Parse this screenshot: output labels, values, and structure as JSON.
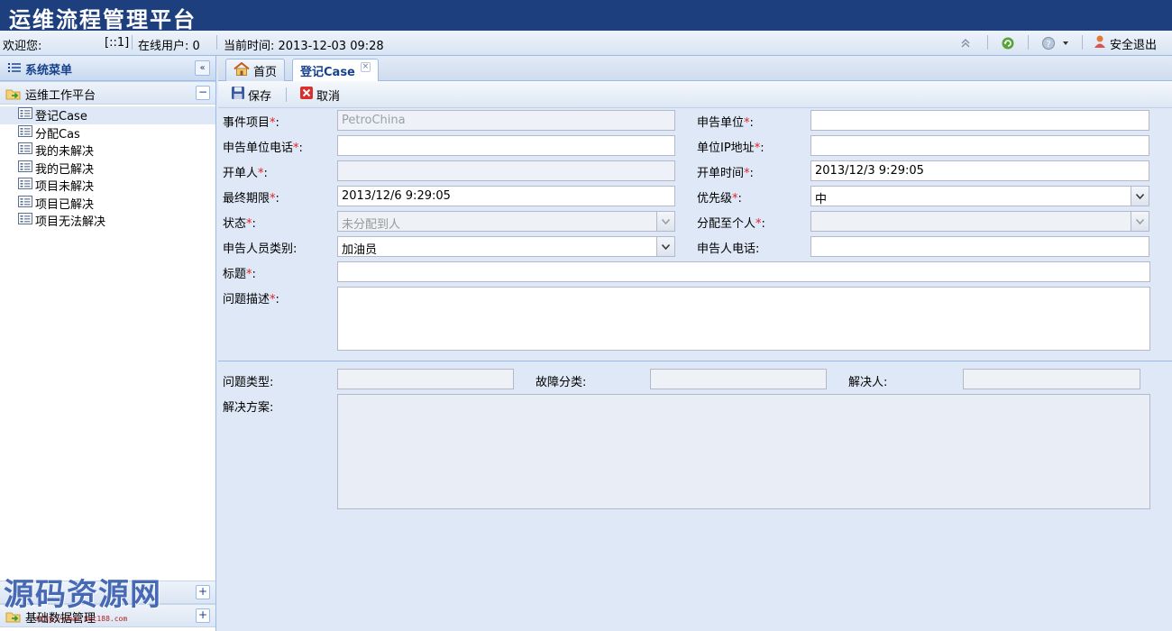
{
  "app": {
    "title": "运维流程管理平台"
  },
  "status": {
    "welcome": "欢迎您:",
    "user_ip": "[::1]",
    "online_users": "在线用户: 0",
    "current_time": "当前时间: 2013-12-03 09:28",
    "logout": "安全退出"
  },
  "sidebar": {
    "title": "系统菜单",
    "groups": [
      {
        "label": "运维工作平台",
        "expanded": true
      },
      {
        "label": "基础数据管理",
        "expanded": false
      }
    ],
    "items": [
      {
        "label": "登记Case"
      },
      {
        "label": "分配Cas"
      },
      {
        "label": "我的未解决"
      },
      {
        "label": "我的已解决"
      },
      {
        "label": "项目未解决"
      },
      {
        "label": "项目已解决"
      },
      {
        "label": "项目无法解决"
      }
    ]
  },
  "tabs": [
    {
      "label": "首页",
      "icon": "home-icon"
    },
    {
      "label": "登记Case",
      "active": true
    }
  ],
  "toolbar": {
    "save": "保存",
    "cancel": "取消"
  },
  "form": {
    "event_project": {
      "label": "事件项目",
      "value": "PetroChina"
    },
    "report_unit": {
      "label": "申告单位",
      "value": ""
    },
    "report_unit_phone": {
      "label": "申告单位电话",
      "value": ""
    },
    "unit_ip": {
      "label": "单位IP地址",
      "value": ""
    },
    "opener": {
      "label": "开单人",
      "value": ""
    },
    "open_time": {
      "label": "开单时间",
      "value": "2013/12/3 9:29:05"
    },
    "deadline": {
      "label": "最终期限",
      "value": "2013/12/6 9:29:05"
    },
    "priority": {
      "label": "优先级",
      "value": "中"
    },
    "state": {
      "label": "状态",
      "value": "未分配到人"
    },
    "assign_to": {
      "label": "分配至个人",
      "value": ""
    },
    "reporter_type": {
      "label": "申告人员类别:",
      "value": "加油员"
    },
    "reporter_phone": {
      "label": "申告人电话:",
      "value": ""
    },
    "subject": {
      "label": "标题",
      "value": ""
    },
    "description": {
      "label": "问题描述",
      "value": ""
    },
    "problem_type": {
      "label": "问题类型:",
      "value": ""
    },
    "fault_class": {
      "label": "故障分类:",
      "value": ""
    },
    "resolver": {
      "label": "解决人:",
      "value": ""
    },
    "solution": {
      "label": "解决方案:",
      "value": ""
    },
    "required_mark": "*",
    "colon": ":"
  },
  "watermark": {
    "text": "源码资源网",
    "url": "http://www.net188.com"
  },
  "colors": {
    "titlebar": "#1e3f7e",
    "panel": "#dfe8f6",
    "border": "#99bbe8",
    "required": "#e02020"
  }
}
